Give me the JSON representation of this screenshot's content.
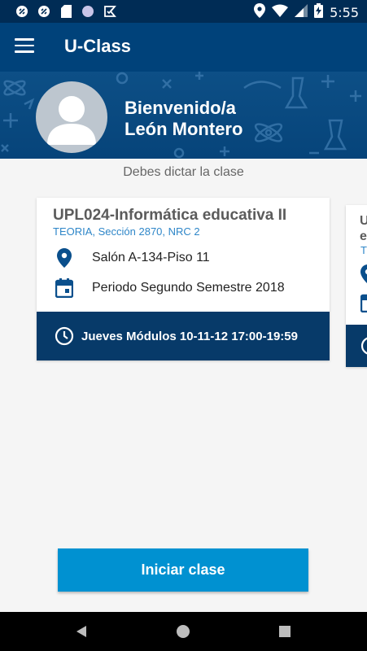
{
  "status_bar": {
    "time": "5:55",
    "left_icons": [
      "data-saver-icon",
      "data-saver-icon",
      "sd-card-icon",
      "circle-icon",
      "check-flag-icon"
    ],
    "right_icons": [
      "location-icon",
      "wifi-icon",
      "signal-icon",
      "battery-charging-icon"
    ]
  },
  "app_bar": {
    "title": "U-Class",
    "menu_icon": "menu-icon"
  },
  "header": {
    "greeting_line1": "Bienvenido/a",
    "greeting_line2": "León Montero"
  },
  "notice": "Debes dictar la clase",
  "card": {
    "title": "UPL024-Informática educativa II",
    "subtitle": "TEORIA, Sección 2870, NRC 2",
    "location": "Salón A-134-Piso 11",
    "period": "Periodo Segundo Semestre 2018",
    "schedule": "Jueves Módulos 10-11-12 17:00-19:59"
  },
  "peek_card": {
    "title_line1": "U",
    "title_line2": "e",
    "subtitle": "T"
  },
  "start_button_label": "Iniciar clase",
  "colors": {
    "status_bar": "#002c55",
    "app_bar": "#00427a",
    "card_footer": "#073a69",
    "accent_blue": "#2e86c8",
    "button": "#0091d1",
    "background": "#f5f5f5"
  }
}
